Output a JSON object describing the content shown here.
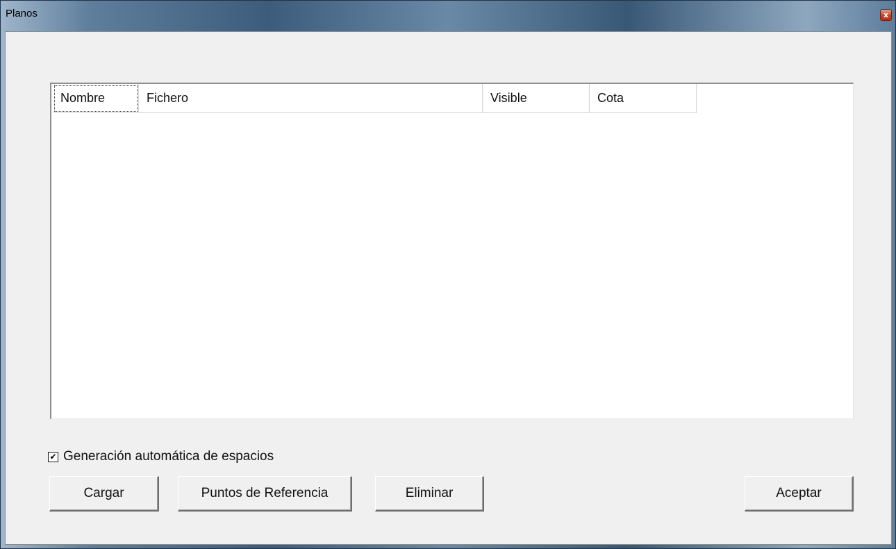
{
  "window": {
    "title": "Planos",
    "close_glyph": "x",
    "close_icon": "close-icon"
  },
  "listview": {
    "columns": [
      "Nombre",
      "Fichero",
      "Visible",
      "Cota"
    ],
    "rows": []
  },
  "options": {
    "auto_spaces_label": "Generación automática de espacios",
    "auto_spaces_checked": true,
    "check_glyph": "✔"
  },
  "buttons": {
    "load": "Cargar",
    "reference_points": "Puntos de Referencia",
    "delete": "Eliminar",
    "accept": "Aceptar"
  },
  "colors": {
    "title_close": "#c9452b",
    "dialog_bg": "#f0f0f0"
  }
}
